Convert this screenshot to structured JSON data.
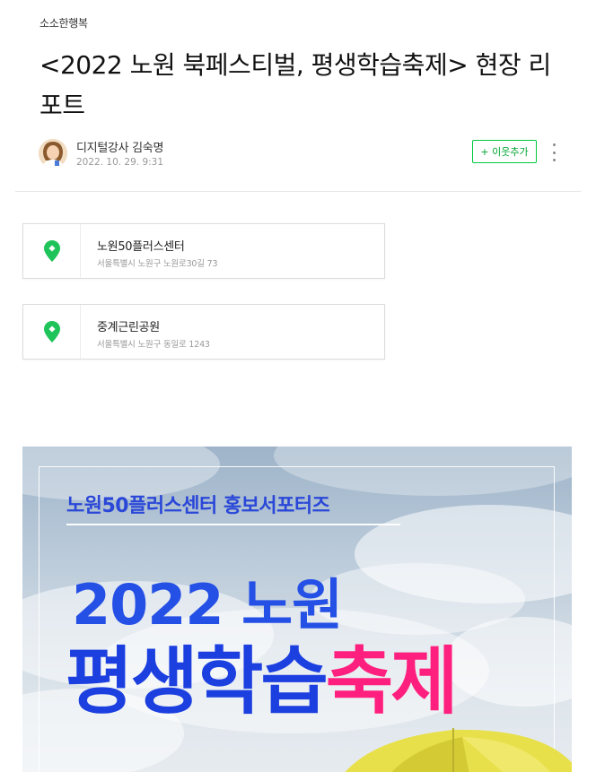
{
  "post": {
    "category": "소소한행복",
    "title": "<2022 노원 북페스티벌, 평생학습축제> 현장 리포트"
  },
  "author": {
    "name": "디지털강사 김숙명",
    "date": "2022. 10. 29. 9:31",
    "follow_label": "+ 이웃추가"
  },
  "places": [
    {
      "name": "노원50플러스센터",
      "address": "서울특별시 노원구 노원로30길 73"
    },
    {
      "name": "중계근린공원",
      "address": "서울특별시 노원구 동일로 1243"
    }
  ],
  "poster": {
    "subtitle": "노원50플러스센터 홍보서포터즈",
    "year_line": "2022 노원",
    "main_blue": "평생학습",
    "main_pink": "축제"
  },
  "colors": {
    "accent_green": "#00c73c",
    "poster_blue": "#1c3fe0",
    "poster_pink": "#ff1f7e"
  }
}
